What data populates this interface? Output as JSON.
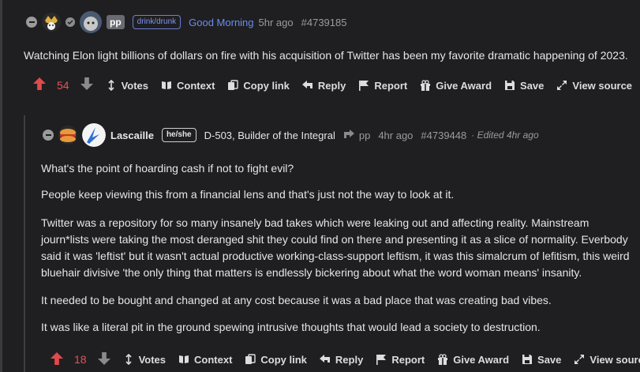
{
  "comment1": {
    "community_tag": "drink/drunk",
    "author_link": "Good Morning",
    "age": "5hr ago",
    "id": "#4739185",
    "badge": "pp",
    "body": "Watching Elon light billions of dollars on fire with his acquisition of Twitter has been my favorite dramatic happening of 2023.",
    "score": "54",
    "actions": {
      "votes": "Votes",
      "context": "Context",
      "copy_link": "Copy link",
      "reply": "Reply",
      "report": "Report",
      "give_award": "Give Award",
      "save": "Save",
      "view_source": "View source",
      "more": "•••"
    }
  },
  "comment2": {
    "author": "Lascaille",
    "pronoun": "he/she",
    "flair": "D-503, Builder of the Integral",
    "reply_to": "pp",
    "age": "4hr ago",
    "id": "#4739448",
    "edited": "· Edited 4hr ago",
    "paragraphs": [
      "What's the point of hoarding cash if not to fight evil?",
      "People keep viewing this from a financial lens and that's just not the way to look at it.",
      "Twitter was a repository for so many insanely bad takes which were leaking out and affecting reality. Mainstream",
      "journ*lists were taking the most deranged shit they could find on there and presenting it as a slice of normality. Everbody",
      "said it was 'leftist' but it wasn't actual productive working-class-support leftism, it was this simalcrum of lefitism, this weird",
      "bluehair divisive 'the only thing that matters is endlessly bickering about what the word woman means' insanity.",
      "It needed to be bought and changed at any cost because it was a bad place that was creating bad vibes.",
      "It was like a literal pit in the ground spewing intrusive thoughts that would lead a society to destruction."
    ],
    "score": "18",
    "actions": {
      "votes": "Votes",
      "context": "Context",
      "copy_link": "Copy link",
      "reply": "Reply",
      "report": "Report",
      "give_award": "Give Award",
      "save": "Save",
      "view_source": "View source"
    }
  },
  "colors": {
    "background": "#1f1f22",
    "upvote": "#e04a4a",
    "link": "#6a8cf0",
    "tag": "#7f95f0"
  }
}
